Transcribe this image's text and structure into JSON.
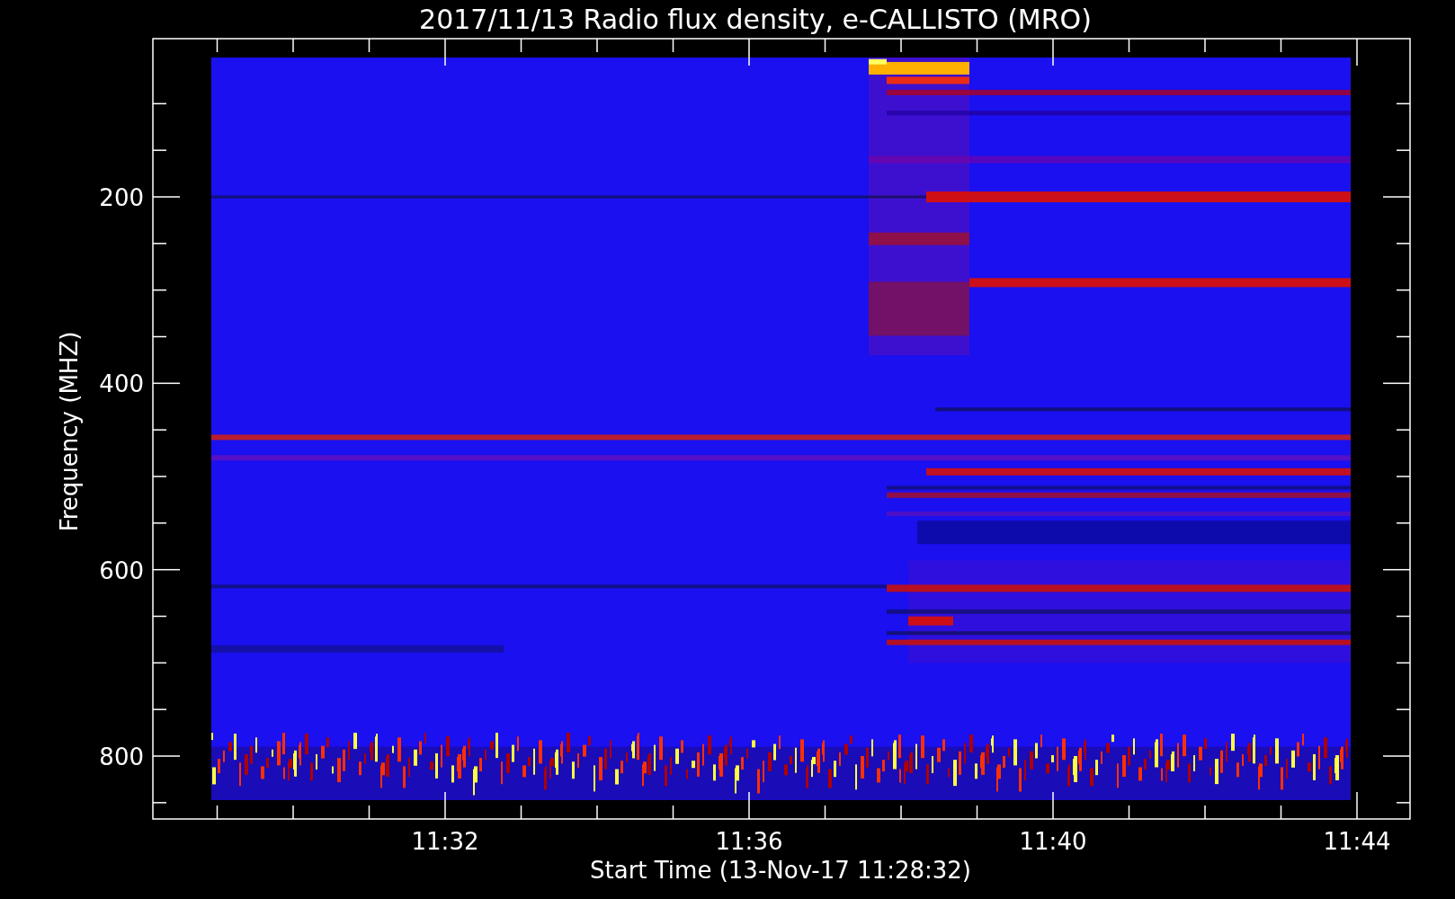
{
  "title": "2017/11/13  Radio flux density, e-CALLISTO (MRO)",
  "y_axis": {
    "label": "Frequency (MHZ)",
    "ticks": [
      "200",
      "400",
      "600",
      "800"
    ]
  },
  "x_axis": {
    "label": "Start Time (13-Nov-17 11:28:32)",
    "ticks": [
      "11:32",
      "11:36",
      "11:40",
      "11:44"
    ]
  }
}
